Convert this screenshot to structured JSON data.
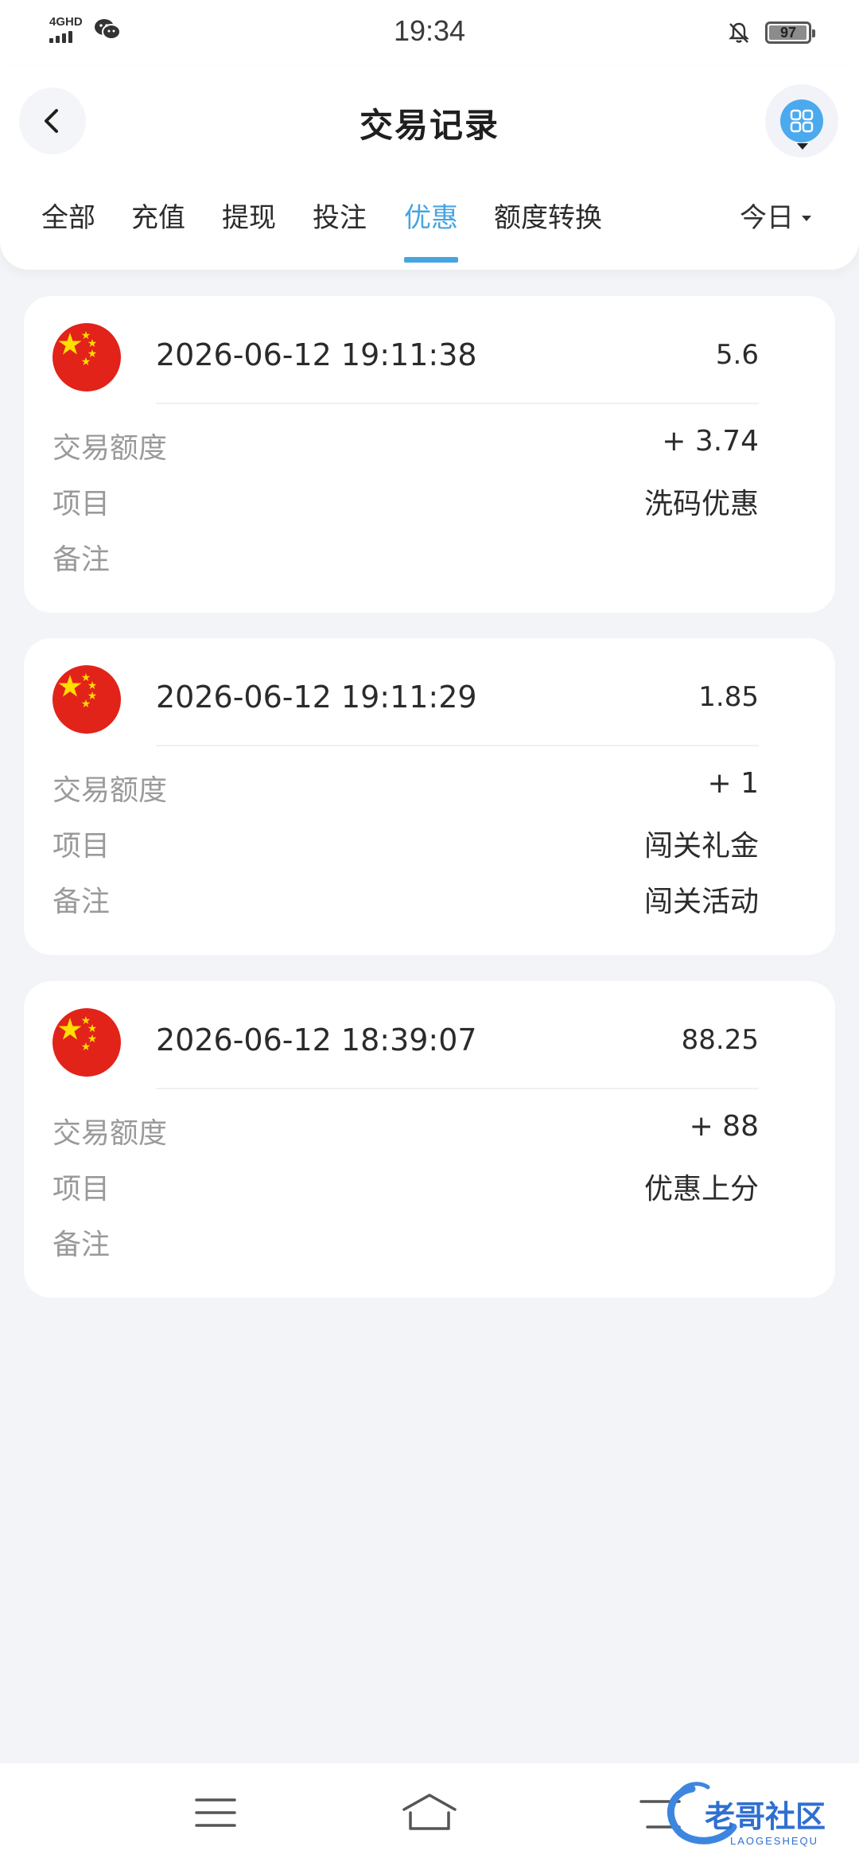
{
  "status_bar": {
    "network": "4GHD",
    "time": "19:34",
    "battery": "97",
    "battery_level": 0.97
  },
  "header": {
    "title": "交易记录",
    "tabs": [
      {
        "label": "全部",
        "active": false
      },
      {
        "label": "充值",
        "active": false
      },
      {
        "label": "提现",
        "active": false
      },
      {
        "label": "投注",
        "active": false
      },
      {
        "label": "优惠",
        "active": true
      },
      {
        "label": "额度转换",
        "active": false
      }
    ],
    "date_filter": "今日"
  },
  "colors": {
    "accent": "#46a4e2",
    "menu_button": "#4ba9ee",
    "label_gray": "#9a9a9a",
    "background": "#f3f4f7"
  },
  "icons": {
    "back": "chevron-left-icon",
    "menu": "grid-icon",
    "flag": "china-flag-icon"
  },
  "records": [
    {
      "time": "2026-06-12 19:11:38",
      "amount": "5.6",
      "rows": [
        {
          "label": "交易额度",
          "value": "+ 3.74"
        },
        {
          "label": "项目",
          "value": "洗码优惠"
        },
        {
          "label": "备注",
          "value": ""
        }
      ]
    },
    {
      "time": "2026-06-12 19:11:29",
      "amount": "1.85",
      "rows": [
        {
          "label": "交易额度",
          "value": "+ 1"
        },
        {
          "label": "项目",
          "value": "闯关礼金"
        },
        {
          "label": "备注",
          "value": "闯关活动"
        }
      ]
    },
    {
      "time": "2026-06-12 18:39:07",
      "amount": "88.25",
      "rows": [
        {
          "label": "交易额度",
          "value": "+ 88"
        },
        {
          "label": "项目",
          "value": "优惠上分"
        },
        {
          "label": "备注",
          "value": ""
        }
      ]
    }
  ],
  "watermark": "老哥社区",
  "watermark_sub": "LAOGESHEQU"
}
